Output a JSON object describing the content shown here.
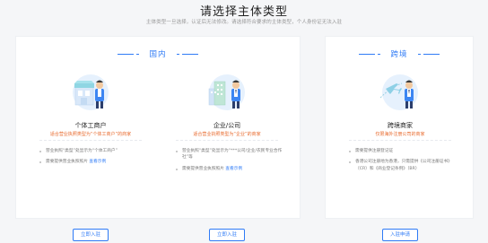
{
  "header": {
    "title": "请选择主体类型",
    "subtitle": "主体类型一旦选择，认证后无法修改。请选择符合要求的主体类型，个人身份证无法入驻"
  },
  "domestic": {
    "label": "国内",
    "cards": {
      "individual": {
        "title": "个体工商户",
        "desc": "适合营业执照类型为“个体工商户”的商家",
        "bullet1": "营业执照“类型”处显示为“个体工商户”",
        "bullet2_text": "需要提供营业执照照片",
        "bullet2_link": "查看示例",
        "button": "立即入驻"
      },
      "company": {
        "title": "企业/公司",
        "desc": "适合营业执照类型为“企业”的商家",
        "bullet1": "营业执照“类型”处显示为“***公司/企业/农民专业合作社”等",
        "bullet2_text": "需要提供营业执照照片",
        "bullet2_link": "查看示例",
        "button": "立即入驻"
      }
    }
  },
  "crossborder": {
    "label": "跨境",
    "card": {
      "title": "跨境商家",
      "desc": "仅限海外注册公司的商家",
      "bullet1": "需要提供注册登记证",
      "bullet2": "香港公司注册地为香港，只需提供《公司注册证书》（CR）和《商业登记条例》（BR）",
      "button": "入驻申请"
    }
  },
  "colors": {
    "accent": "#2f7bf6",
    "desc_orange": "#e8692c"
  }
}
